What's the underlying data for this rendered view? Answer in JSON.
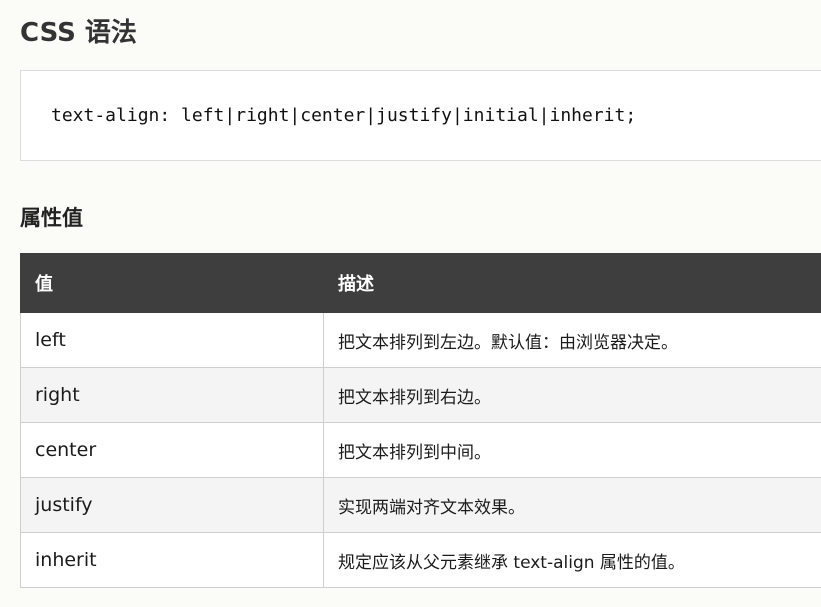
{
  "heading": "CSS 语法",
  "syntax_code": "text-align: left|right|center|justify|initial|inherit;",
  "subheading": "属性值",
  "table": {
    "headers": [
      "值",
      "描述"
    ],
    "rows": [
      {
        "value": "left",
        "desc": "把文本排列到左边。默认值：由浏览器决定。"
      },
      {
        "value": "right",
        "desc": "把文本排列到右边。"
      },
      {
        "value": "center",
        "desc": "把文本排列到中间。"
      },
      {
        "value": "justify",
        "desc": "实现两端对齐文本效果。"
      },
      {
        "value": "inherit",
        "desc": "规定应该从父元素继承 text-align 属性的值。"
      }
    ]
  }
}
